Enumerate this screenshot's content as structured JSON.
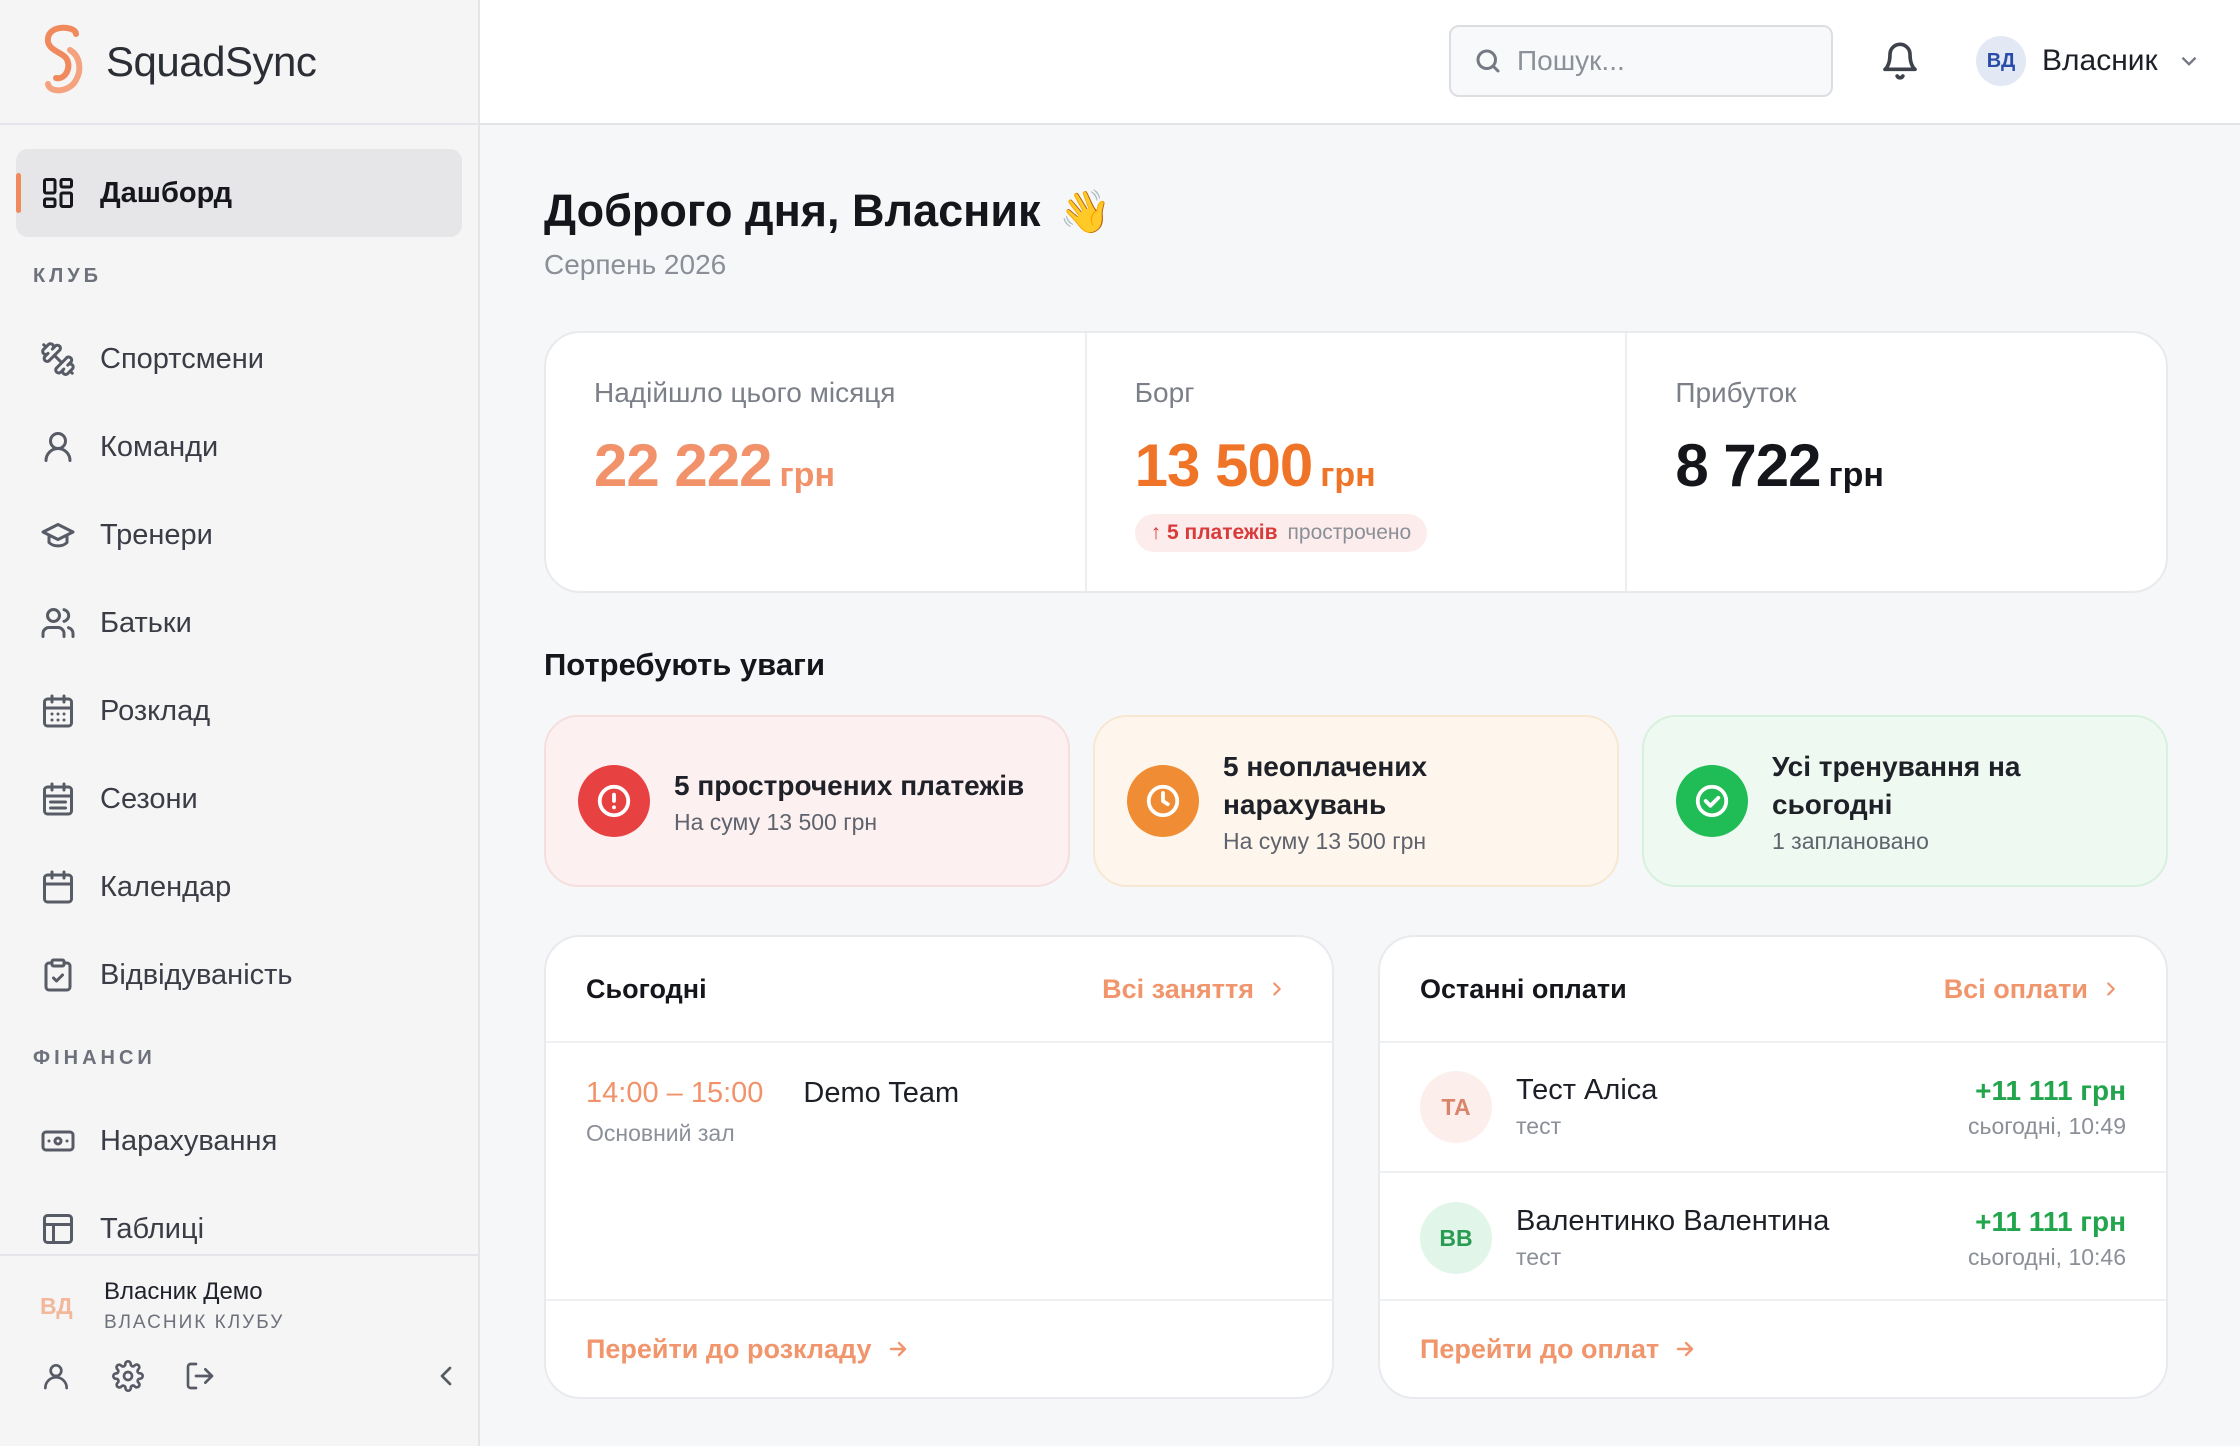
{
  "brand": {
    "name": "SquadSync",
    "accent": "#f08a5d"
  },
  "sidebar": {
    "dashboard": {
      "label": "Дашборд",
      "icon": "dashboard-icon"
    },
    "club_section": "КЛУБ",
    "club_items": [
      {
        "label": "Спортсмени",
        "icon": "dumbbell-icon"
      },
      {
        "label": "Команди",
        "icon": "team-icon"
      },
      {
        "label": "Тренери",
        "icon": "graduation-cap-icon"
      },
      {
        "label": "Батьки",
        "icon": "parents-icon"
      },
      {
        "label": "Розклад",
        "icon": "schedule-icon"
      },
      {
        "label": "Сезони",
        "icon": "seasons-icon"
      },
      {
        "label": "Календар",
        "icon": "calendar-icon"
      },
      {
        "label": "Відвідуваність",
        "icon": "clipboard-check-icon"
      }
    ],
    "finance_section": "ФІНАНСИ",
    "finance_items": [
      {
        "label": "Нарахування",
        "icon": "banknote-icon"
      },
      {
        "label": "Таблиці",
        "icon": "table-icon"
      }
    ],
    "user": {
      "initials": "ВД",
      "name": "Власник Демо",
      "role": "ВЛАСНИК КЛУБУ"
    }
  },
  "topbar": {
    "search_placeholder": "Пошук...",
    "user_initials": "ВД",
    "user_name": "Власник"
  },
  "main": {
    "greeting": "Доброго дня, Власник",
    "greeting_emoji": "👋",
    "month": "Серпень 2026",
    "stats": {
      "income": {
        "label": "Надійшло цього місяця",
        "value": "22 222",
        "currency": "грн"
      },
      "debt": {
        "label": "Борг",
        "value": "13 500",
        "currency": "грн",
        "badge_count": "↑ 5 платежів",
        "badge_text": "прострочено"
      },
      "profit": {
        "label": "Прибуток",
        "value": "8 722",
        "currency": "грн"
      }
    },
    "attention_title": "Потребують уваги",
    "alerts": [
      {
        "title": "5 прострочених платежів",
        "sub": "На суму 13 500 грн",
        "color": "#e84141"
      },
      {
        "title": "5 неоплачених нарахувань",
        "sub": "На суму 13 500 грн",
        "color": "#f08d34"
      },
      {
        "title": "Усі тренування на сьогодні",
        "sub": "1 заплановано",
        "color": "#20bc55"
      }
    ],
    "today": {
      "title": "Сьогодні",
      "link": "Всі заняття",
      "session": {
        "time": "14:00 – 15:00",
        "place": "Основний зал",
        "team": "Demo Team"
      },
      "footer_link": "Перейти до розкладу"
    },
    "payments": {
      "title": "Останні оплати",
      "link": "Всі оплати",
      "items": [
        {
          "initials": "ТА",
          "name": "Тест Аліса",
          "note": "тест",
          "amount": "+11 111 грн",
          "time": "сьогодні, 10:49"
        },
        {
          "initials": "ВВ",
          "name": "Валентинко Валентина",
          "note": "тест",
          "amount": "+11 111 грн",
          "time": "сьогодні, 10:46"
        }
      ],
      "footer_link": "Перейти до оплат"
    }
  }
}
